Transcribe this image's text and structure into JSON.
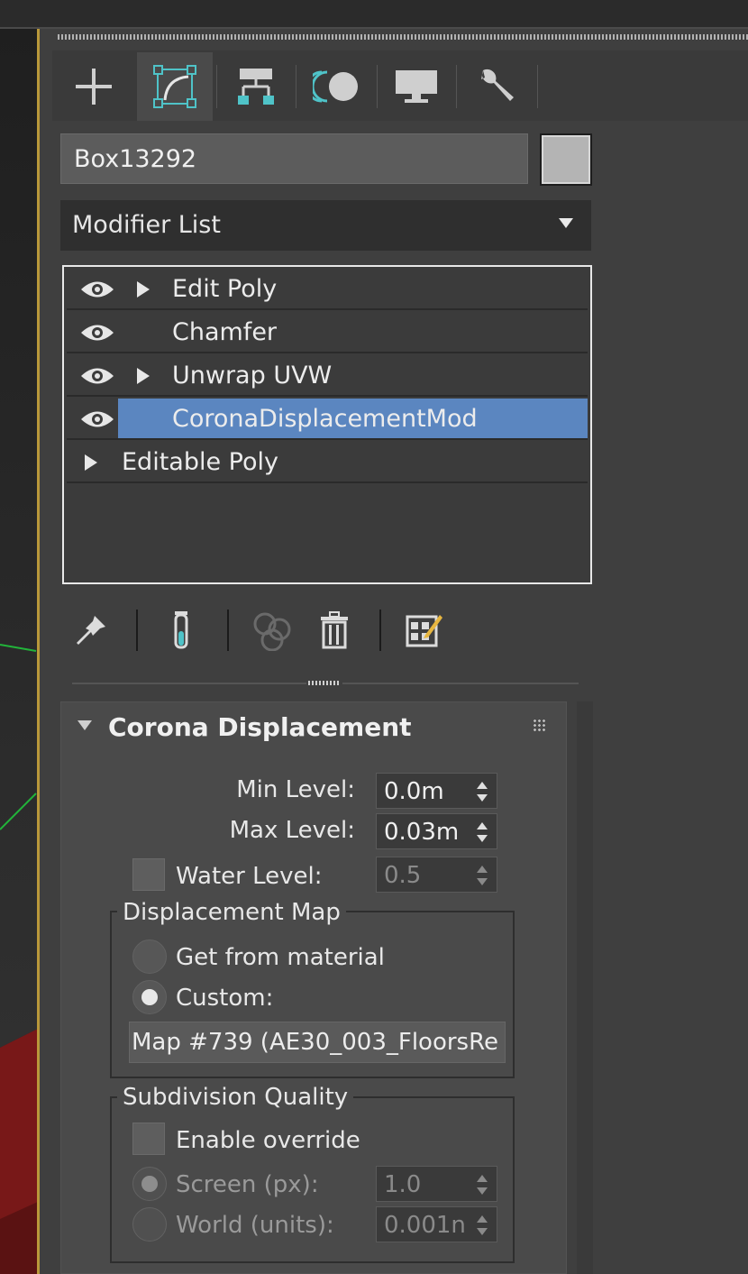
{
  "tabs": [
    {
      "name": "create",
      "active": false
    },
    {
      "name": "modify",
      "active": true
    },
    {
      "name": "hierarchy",
      "active": false
    },
    {
      "name": "motion",
      "active": false
    },
    {
      "name": "display",
      "active": false
    },
    {
      "name": "utilities",
      "active": false
    }
  ],
  "object": {
    "name": "Box13292",
    "color": "#b4b4b4"
  },
  "modifier_list": {
    "label": "Modifier List"
  },
  "stack": {
    "items": [
      {
        "label": "Edit Poly",
        "eye": true,
        "expandable": true,
        "selected": false
      },
      {
        "label": "Chamfer",
        "eye": true,
        "expandable": false,
        "selected": false
      },
      {
        "label": "Unwrap UVW",
        "eye": true,
        "expandable": true,
        "selected": false
      },
      {
        "label": "CoronaDisplacementMod",
        "eye": true,
        "expandable": false,
        "selected": true
      },
      {
        "label": "Editable Poly",
        "eye": false,
        "expandable": true,
        "selected": false
      }
    ]
  },
  "toolbar": [
    "pin-icon",
    "show-end-result-icon",
    "make-unique-icon",
    "remove-modifier-icon",
    "configure-modifier-sets-icon"
  ],
  "rollout": {
    "title": "Corona Displacement",
    "min_level": {
      "label": "Min Level:",
      "value": "0.0m"
    },
    "max_level": {
      "label": "Max Level:",
      "value": "0.03m"
    },
    "water_level": {
      "label": "Water Level:",
      "value": "0.5",
      "checked": false,
      "enabled": false
    },
    "displacement_map": {
      "group_label": "Displacement Map",
      "get_from_material": "Get from material",
      "custom": "Custom:",
      "selected": "custom",
      "map_button": "Map #739 (AE30_003_FloorsRe"
    },
    "subdivision_quality": {
      "group_label": "Subdivision Quality",
      "enable_override": "Enable override",
      "enable_checked": false,
      "screen": {
        "label": "Screen (px):",
        "value": "1.0"
      },
      "world": {
        "label": "World (units):",
        "value": "0.001n"
      },
      "selected": "screen"
    }
  },
  "colors": {
    "accent_selection": "#5b86c0",
    "viewport_border": "#b9983a",
    "teal_icon": "#4fc3c8"
  }
}
